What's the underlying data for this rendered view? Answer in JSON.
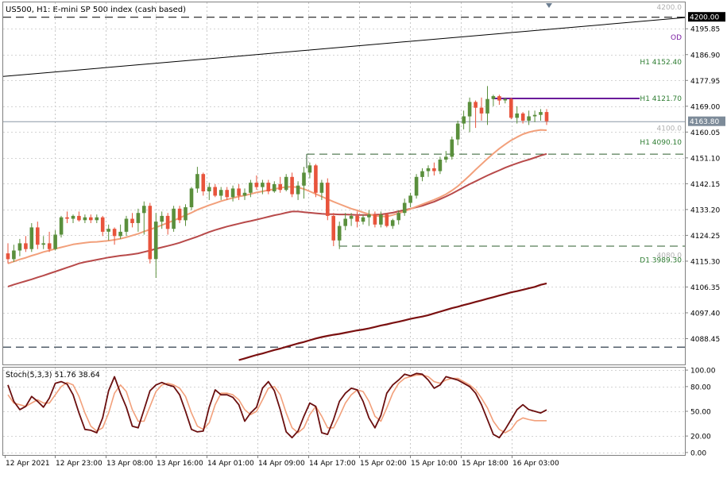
{
  "chart_data": {
    "type": "candlestick",
    "title": "US500, H1:  E-mini SP 500 index (cash based)",
    "colors": {
      "background": "#ffffff",
      "up_candle": "#5a8f3c",
      "down_candle": "#e8543c",
      "ma_fast": "#f2a07b",
      "ma_mid": "#b84a4a",
      "ma_slow": "#7a1010",
      "stoch_main": "#6b0f0f",
      "stoch_signal": "#f2a07b",
      "purple_line": "#6a1b9a",
      "dashed_level": "#1a1a1a",
      "green_dashed": "#2e5e2e",
      "label_green": "#2e7d32",
      "label_gray": "#b0b0b0",
      "label_purple": "#7b1fa2",
      "current_price_box": "#7d8b99"
    },
    "price_axis": {
      "ticks": [
        "4195.85",
        "4186.90",
        "4177.95",
        "4169.00",
        "4160.05",
        "4151.10",
        "4142.15",
        "4133.20",
        "4124.25",
        "4115.30",
        "4106.35",
        "4097.40",
        "4088.45"
      ],
      "ylim": [
        4079.5,
        4205.0
      ]
    },
    "time_axis": {
      "labels": [
        "12 Apr 2021",
        "12 Apr 23:00",
        "13 Apr 08:00",
        "13 Apr 16:00",
        "14 Apr 01:00",
        "14 Apr 09:00",
        "14 Apr 17:00",
        "15 Apr 02:00",
        "15 Apr 10:00",
        "15 Apr 18:00",
        "16 Apr 03:00"
      ]
    },
    "levels": {
      "top_dashed_label": "4200.00",
      "top_faint_label": "4200.0",
      "od_label": "OD",
      "h1_4152_label": "H1 4152.40",
      "h1_4121_label": "H1 4121.70",
      "current_price_label": "4163.80",
      "faint_4100_label": "4100.0",
      "h1_4090_label": "H1 4090.10",
      "faint_4080_label": "4080.0",
      "d1_label": "D1 3989.30"
    },
    "candles": [
      {
        "o": 4118.0,
        "h": 4121.5,
        "l": 4114.5,
        "c": 4116.0
      },
      {
        "o": 4116.0,
        "h": 4121.0,
        "l": 4115.0,
        "c": 4119.0
      },
      {
        "o": 4119.0,
        "h": 4123.0,
        "l": 4117.0,
        "c": 4121.5
      },
      {
        "o": 4121.5,
        "h": 4124.0,
        "l": 4118.5,
        "c": 4119.5
      },
      {
        "o": 4119.5,
        "h": 4128.5,
        "l": 4118.5,
        "c": 4127.0
      },
      {
        "o": 4127.0,
        "h": 4129.0,
        "l": 4119.5,
        "c": 4121.0
      },
      {
        "o": 4121.0,
        "h": 4124.0,
        "l": 4119.5,
        "c": 4121.5
      },
      {
        "o": 4121.5,
        "h": 4125.5,
        "l": 4118.5,
        "c": 4119.5
      },
      {
        "o": 4119.5,
        "h": 4126.0,
        "l": 4119.0,
        "c": 4124.5
      },
      {
        "o": 4124.5,
        "h": 4131.0,
        "l": 4123.5,
        "c": 4130.5
      },
      {
        "o": 4130.5,
        "h": 4132.5,
        "l": 4128.5,
        "c": 4130.0
      },
      {
        "o": 4130.0,
        "h": 4131.5,
        "l": 4128.5,
        "c": 4131.0
      },
      {
        "o": 4131.0,
        "h": 4132.5,
        "l": 4129.0,
        "c": 4129.5
      },
      {
        "o": 4129.5,
        "h": 4131.5,
        "l": 4128.5,
        "c": 4130.5
      },
      {
        "o": 4130.5,
        "h": 4131.5,
        "l": 4128.5,
        "c": 4129.5
      },
      {
        "o": 4129.5,
        "h": 4131.5,
        "l": 4128.5,
        "c": 4130.5
      },
      {
        "o": 4130.5,
        "h": 4131.0,
        "l": 4124.0,
        "c": 4125.5
      },
      {
        "o": 4125.5,
        "h": 4128.0,
        "l": 4122.5,
        "c": 4126.5
      },
      {
        "o": 4126.5,
        "h": 4127.0,
        "l": 4121.0,
        "c": 4124.0
      },
      {
        "o": 4124.0,
        "h": 4128.0,
        "l": 4123.0,
        "c": 4125.5
      },
      {
        "o": 4125.5,
        "h": 4131.0,
        "l": 4124.0,
        "c": 4130.0
      },
      {
        "o": 4130.0,
        "h": 4132.0,
        "l": 4127.0,
        "c": 4128.5
      },
      {
        "o": 4128.5,
        "h": 4133.5,
        "l": 4125.5,
        "c": 4132.0
      },
      {
        "o": 4132.0,
        "h": 4136.0,
        "l": 4124.5,
        "c": 4134.5
      },
      {
        "o": 4134.5,
        "h": 4135.5,
        "l": 4114.5,
        "c": 4116.0
      },
      {
        "o": 4116.0,
        "h": 4132.0,
        "l": 4109.5,
        "c": 4129.0
      },
      {
        "o": 4129.0,
        "h": 4132.5,
        "l": 4126.5,
        "c": 4131.0
      },
      {
        "o": 4131.0,
        "h": 4132.0,
        "l": 4124.5,
        "c": 4126.5
      },
      {
        "o": 4126.5,
        "h": 4134.5,
        "l": 4125.5,
        "c": 4133.5
      },
      {
        "o": 4133.5,
        "h": 4134.5,
        "l": 4128.5,
        "c": 4129.5
      },
      {
        "o": 4129.5,
        "h": 4135.0,
        "l": 4127.5,
        "c": 4134.0
      },
      {
        "o": 4134.0,
        "h": 4141.0,
        "l": 4133.0,
        "c": 4140.5
      },
      {
        "o": 4140.5,
        "h": 4148.0,
        "l": 4139.0,
        "c": 4145.5
      },
      {
        "o": 4145.5,
        "h": 4146.0,
        "l": 4138.0,
        "c": 4139.5
      },
      {
        "o": 4139.5,
        "h": 4142.5,
        "l": 4136.5,
        "c": 4141.0
      },
      {
        "o": 4141.0,
        "h": 4142.0,
        "l": 4137.5,
        "c": 4138.0
      },
      {
        "o": 4138.0,
        "h": 4141.0,
        "l": 4136.5,
        "c": 4140.0
      },
      {
        "o": 4140.0,
        "h": 4141.0,
        "l": 4136.5,
        "c": 4137.5
      },
      {
        "o": 4137.5,
        "h": 4141.5,
        "l": 4136.0,
        "c": 4140.5
      },
      {
        "o": 4140.5,
        "h": 4142.0,
        "l": 4136.5,
        "c": 4138.0
      },
      {
        "o": 4138.0,
        "h": 4140.5,
        "l": 4136.5,
        "c": 4139.0
      },
      {
        "o": 4139.0,
        "h": 4143.5,
        "l": 4137.5,
        "c": 4142.5
      },
      {
        "o": 4142.5,
        "h": 4145.0,
        "l": 4140.0,
        "c": 4141.0
      },
      {
        "o": 4141.0,
        "h": 4143.5,
        "l": 4138.5,
        "c": 4142.5
      },
      {
        "o": 4142.5,
        "h": 4143.5,
        "l": 4138.5,
        "c": 4139.5
      },
      {
        "o": 4139.5,
        "h": 4143.0,
        "l": 4139.0,
        "c": 4142.0
      },
      {
        "o": 4142.0,
        "h": 4144.5,
        "l": 4139.0,
        "c": 4140.0
      },
      {
        "o": 4140.0,
        "h": 4145.5,
        "l": 4139.5,
        "c": 4144.5
      },
      {
        "o": 4144.5,
        "h": 4146.0,
        "l": 4137.5,
        "c": 4138.5
      },
      {
        "o": 4138.5,
        "h": 4143.0,
        "l": 4136.5,
        "c": 4141.5
      },
      {
        "o": 4141.5,
        "h": 4148.0,
        "l": 4137.0,
        "c": 4146.0
      },
      {
        "o": 4146.0,
        "h": 4149.5,
        "l": 4144.0,
        "c": 4148.5
      },
      {
        "o": 4148.5,
        "h": 4149.0,
        "l": 4137.5,
        "c": 4139.0
      },
      {
        "o": 4139.0,
        "h": 4143.5,
        "l": 4136.5,
        "c": 4142.5
      },
      {
        "o": 4142.5,
        "h": 4144.0,
        "l": 4129.5,
        "c": 4131.0
      },
      {
        "o": 4131.0,
        "h": 4132.0,
        "l": 4120.5,
        "c": 4122.5
      },
      {
        "o": 4122.5,
        "h": 4129.0,
        "l": 4119.5,
        "c": 4127.5
      },
      {
        "o": 4127.5,
        "h": 4132.0,
        "l": 4126.0,
        "c": 4130.0
      },
      {
        "o": 4130.0,
        "h": 4132.0,
        "l": 4127.5,
        "c": 4131.0
      },
      {
        "o": 4131.0,
        "h": 4132.5,
        "l": 4127.0,
        "c": 4129.0
      },
      {
        "o": 4129.0,
        "h": 4131.5,
        "l": 4128.0,
        "c": 4130.5
      },
      {
        "o": 4130.5,
        "h": 4133.0,
        "l": 4127.5,
        "c": 4131.5
      },
      {
        "o": 4131.5,
        "h": 4132.5,
        "l": 4127.0,
        "c": 4128.0
      },
      {
        "o": 4128.0,
        "h": 4132.5,
        "l": 4127.0,
        "c": 4131.5
      },
      {
        "o": 4131.5,
        "h": 4132.0,
        "l": 4127.0,
        "c": 4127.5
      },
      {
        "o": 4127.5,
        "h": 4130.0,
        "l": 4126.5,
        "c": 4129.5
      },
      {
        "o": 4129.5,
        "h": 4133.0,
        "l": 4128.0,
        "c": 4132.0
      },
      {
        "o": 4132.0,
        "h": 4137.0,
        "l": 4131.0,
        "c": 4135.5
      },
      {
        "o": 4135.5,
        "h": 4139.0,
        "l": 4134.0,
        "c": 4138.0
      },
      {
        "o": 4138.0,
        "h": 4145.5,
        "l": 4137.0,
        "c": 4144.5
      },
      {
        "o": 4144.5,
        "h": 4147.5,
        "l": 4143.0,
        "c": 4146.5
      },
      {
        "o": 4146.5,
        "h": 4148.5,
        "l": 4144.5,
        "c": 4147.5
      },
      {
        "o": 4147.5,
        "h": 4149.5,
        "l": 4145.0,
        "c": 4146.5
      },
      {
        "o": 4146.5,
        "h": 4151.5,
        "l": 4145.5,
        "c": 4150.5
      },
      {
        "o": 4150.5,
        "h": 4153.5,
        "l": 4149.5,
        "c": 4151.5
      },
      {
        "o": 4151.5,
        "h": 4158.5,
        "l": 4150.5,
        "c": 4157.5
      },
      {
        "o": 4157.5,
        "h": 4164.0,
        "l": 4155.5,
        "c": 4163.0
      },
      {
        "o": 4163.0,
        "h": 4167.5,
        "l": 4161.0,
        "c": 4165.5
      },
      {
        "o": 4165.5,
        "h": 4172.0,
        "l": 4160.0,
        "c": 4170.5
      },
      {
        "o": 4170.5,
        "h": 4171.0,
        "l": 4161.5,
        "c": 4168.5
      },
      {
        "o": 4168.5,
        "h": 4172.0,
        "l": 4164.0,
        "c": 4166.5
      },
      {
        "o": 4166.5,
        "h": 4176.0,
        "l": 4162.5,
        "c": 4171.5
      },
      {
        "o": 4171.5,
        "h": 4173.0,
        "l": 4169.0,
        "c": 4172.5
      },
      {
        "o": 4172.5,
        "h": 4173.0,
        "l": 4169.5,
        "c": 4171.0
      },
      {
        "o": 4171.0,
        "h": 4172.0,
        "l": 4170.0,
        "c": 4171.5
      },
      {
        "o": 4171.5,
        "h": 4172.0,
        "l": 4164.5,
        "c": 4165.0
      },
      {
        "o": 4165.0,
        "h": 4169.0,
        "l": 4163.0,
        "c": 4166.5
      },
      {
        "o": 4166.5,
        "h": 4167.0,
        "l": 4163.0,
        "c": 4164.0
      },
      {
        "o": 4164.0,
        "h": 4167.5,
        "l": 4162.5,
        "c": 4165.5
      },
      {
        "o": 4165.5,
        "h": 4167.5,
        "l": 4163.5,
        "c": 4166.0
      },
      {
        "o": 4166.0,
        "h": 4168.0,
        "l": 4164.0,
        "c": 4167.0
      },
      {
        "o": 4167.0,
        "h": 4168.0,
        "l": 4162.5,
        "c": 4163.8
      }
    ],
    "ma_fast": [
      4114.5,
      4115.2,
      4115.9,
      4116.5,
      4117.2,
      4117.8,
      4118.5,
      4119.0,
      4119.6,
      4120.1,
      4120.6,
      4121.1,
      4121.4,
      4121.7,
      4121.9,
      4122.0,
      4122.2,
      4122.4,
      4122.7,
      4123.1,
      4123.6,
      4124.2,
      4124.8,
      4125.6,
      4126.3,
      4127.0,
      4127.8,
      4128.6,
      4129.4,
      4130.3,
      4131.2,
      4132.1,
      4133.1,
      4133.9,
      4134.7,
      4135.4,
      4136.1,
      4136.7,
      4137.2,
      4137.7,
      4138.1,
      4138.6,
      4139.1,
      4139.5,
      4139.9,
      4140.3,
      4140.7,
      4141.0,
      4141.1,
      4140.9,
      4140.3,
      4139.5,
      4138.6,
      4137.7,
      4136.8,
      4135.9,
      4135.1,
      4134.3,
      4133.5,
      4132.9,
      4132.2,
      4131.6,
      4131.1,
      4130.8,
      4130.8,
      4131.3,
      4131.9,
      4132.6,
      4133.4,
      4134.2,
      4135.0,
      4135.8,
      4136.6,
      4137.5,
      4138.5,
      4139.8,
      4141.3,
      4143.1,
      4145.0,
      4147.0,
      4148.9,
      4150.8,
      4152.6,
      4154.3,
      4155.8,
      4157.2,
      4158.3,
      4159.3,
      4160.0,
      4160.5,
      4160.8,
      4160.7
    ],
    "ma_mid": [
      4106.5,
      4107.2,
      4107.8,
      4108.4,
      4109.0,
      4109.7,
      4110.3,
      4111.0,
      4111.7,
      4112.4,
      4113.1,
      4113.8,
      4114.5,
      4115.0,
      4115.4,
      4115.8,
      4116.2,
      4116.6,
      4116.9,
      4117.2,
      4117.4,
      4117.7,
      4118.0,
      4118.5,
      4119.0,
      4119.6,
      4120.1,
      4120.6,
      4121.1,
      4121.7,
      4122.4,
      4123.1,
      4123.8,
      4124.6,
      4125.4,
      4126.1,
      4126.7,
      4127.3,
      4127.8,
      4128.3,
      4128.8,
      4129.2,
      4129.7,
      4130.2,
      4130.7,
      4131.2,
      4131.6,
      4132.1,
      4132.5,
      4132.5,
      4132.3,
      4132.1,
      4131.9,
      4131.7,
      4131.6,
      4131.6,
      4131.5,
      4131.5,
      4131.4,
      4131.3,
      4131.3,
      4131.3,
      4131.4,
      4131.5,
      4131.8,
      4132.1,
      4132.6,
      4133.0,
      4133.5,
      4134.0,
      4134.5,
      4135.2,
      4135.9,
      4136.8,
      4137.7,
      4138.7,
      4139.8,
      4140.9,
      4142.0,
      4143.0,
      4144.0,
      4145.0,
      4145.9,
      4146.8,
      4147.7,
      4148.5,
      4149.2,
      4149.9,
      4150.5,
      4151.2,
      4151.9,
      4152.5
    ],
    "ma_slow_segment": [
      4081.0,
      4081.6,
      4082.2,
      4082.8,
      4083.3,
      4083.9,
      4084.5,
      4085.0,
      4085.6,
      4086.2,
      4086.8,
      4087.3,
      4087.9,
      4088.5,
      4089.0,
      4089.4,
      4089.8,
      4090.1,
      4090.5,
      4090.9,
      4091.3,
      4091.6,
      4092.0,
      4092.5,
      4093.0,
      4093.4,
      4093.9,
      4094.3,
      4094.8,
      4095.3,
      4095.7,
      4096.1,
      4096.6,
      4097.2,
      4097.8,
      4098.4,
      4099.0,
      4099.5,
      4100.1,
      4100.6,
      4101.2,
      4101.7,
      4102.3,
      4102.8,
      4103.4,
      4103.9,
      4104.5,
      4104.9,
      4105.4,
      4105.9,
      4106.4,
      4107.1,
      4107.6
    ],
    "stoch_label": "Stoch(5,3,3) 51.76 38.64",
    "stoch_axis": {
      "ticks": [
        "100.00",
        "80.00",
        "50.00",
        "20.00",
        "0.00"
      ],
      "ylim": [
        -3,
        103
      ]
    },
    "stoch_main": [
      82,
      62,
      52,
      56,
      68,
      62,
      55,
      66,
      84,
      86,
      83,
      70,
      48,
      28,
      27,
      24,
      42,
      75,
      92,
      72,
      55,
      32,
      30,
      52,
      75,
      82,
      85,
      82,
      80,
      70,
      50,
      28,
      25,
      26,
      55,
      76,
      70,
      70,
      67,
      58,
      38,
      48,
      55,
      78,
      86,
      75,
      52,
      25,
      18,
      26,
      44,
      60,
      56,
      24,
      22,
      40,
      62,
      72,
      78,
      76,
      62,
      42,
      30,
      45,
      72,
      82,
      88,
      95,
      93,
      96,
      95,
      88,
      78,
      82,
      92,
      90,
      88,
      84,
      80,
      72,
      58,
      40,
      22,
      18,
      28,
      40,
      52,
      58,
      52,
      50,
      48,
      51.76
    ],
    "stoch_signal": [
      70,
      60,
      58,
      56,
      60,
      64,
      60,
      60,
      70,
      80,
      85,
      82,
      68,
      48,
      32,
      26,
      30,
      48,
      72,
      82,
      74,
      52,
      38,
      38,
      56,
      74,
      82,
      84,
      82,
      78,
      68,
      48,
      32,
      28,
      36,
      58,
      72,
      72,
      70,
      64,
      52,
      46,
      50,
      64,
      78,
      80,
      70,
      48,
      30,
      24,
      30,
      46,
      56,
      44,
      30,
      30,
      44,
      60,
      70,
      76,
      74,
      62,
      44,
      38,
      54,
      72,
      84,
      90,
      92,
      94,
      94,
      92,
      86,
      84,
      88,
      90,
      90,
      86,
      82,
      76,
      66,
      54,
      38,
      28,
      24,
      28,
      38,
      42,
      40,
      38.64,
      38.64,
      38.64
    ]
  }
}
